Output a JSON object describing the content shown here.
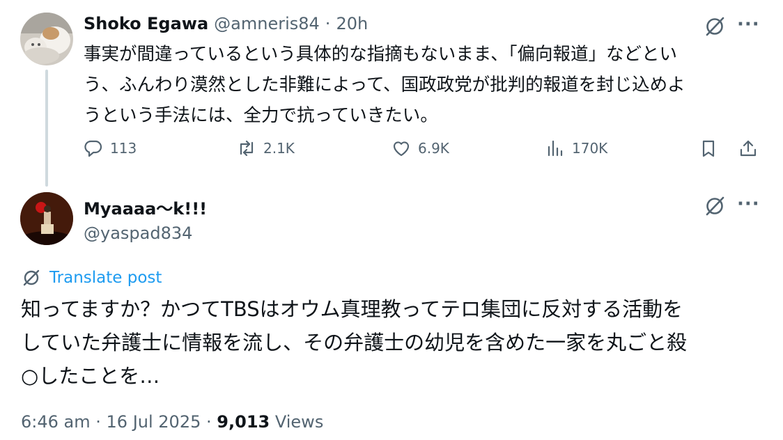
{
  "parent_tweet": {
    "author_name": "Shoko Egawa",
    "handle": "@amneris84",
    "separator": "·",
    "time": "20h",
    "text_lines": [
      "事実が間違っているという具体的な指摘もないまま、「偏向報道」などとい",
      "う、ふんわり漠然とした非難によって、国政政党が批判的報道を封じ込めよ",
      "うという手法には、全力で抗っていきたい。"
    ],
    "actions": {
      "replies": "113",
      "reposts": "2.1K",
      "likes": "6.9K",
      "views": "170K"
    }
  },
  "main_tweet": {
    "author_name": "Myaaaa〜k!!!",
    "handle": "@yaspad834",
    "translate_label": "Translate post",
    "text_lines": [
      "知ってますか？かつてTBSはオウム真理教ってテロ集団に反対する活動を",
      "していた弁護士に情報を流し、その弁護士の幼児を含めた一家を丸ごと殺",
      "○したことを…"
    ],
    "footer": {
      "time": "6:46 am",
      "sep1": "·",
      "date": "16 Jul 2025",
      "sep2": "·",
      "views_count": "9,013",
      "views_label": "Views"
    }
  },
  "icons": {
    "more": "more-icon",
    "grok": "grok-icon",
    "reply": "reply-icon",
    "repost": "repost-icon",
    "like": "like-icon",
    "views": "views-icon",
    "bookmark": "bookmark-icon",
    "share": "share-icon"
  },
  "colors": {
    "accent": "#1d9bf0",
    "secondary": "#536471",
    "text": "#0f1419"
  }
}
